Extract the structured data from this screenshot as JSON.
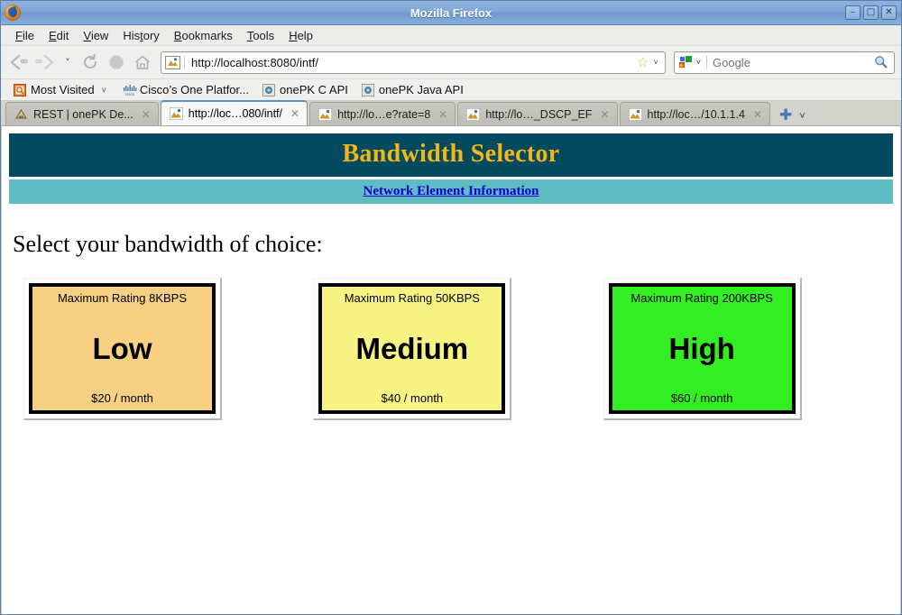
{
  "window": {
    "title": "Mozilla Firefox",
    "minimize_label": "–",
    "maximize_label": "□",
    "close_label": "✕"
  },
  "menubar": {
    "items": [
      {
        "pre": "",
        "key": "F",
        "post": "ile"
      },
      {
        "pre": "",
        "key": "E",
        "post": "dit"
      },
      {
        "pre": "",
        "key": "V",
        "post": "iew"
      },
      {
        "pre": "His",
        "key": "t",
        "post": "ory"
      },
      {
        "pre": "",
        "key": "B",
        "post": "ookmarks"
      },
      {
        "pre": "",
        "key": "T",
        "post": "ools"
      },
      {
        "pre": "",
        "key": "H",
        "post": "elp"
      }
    ]
  },
  "navbar": {
    "back_label": "❮",
    "forward_label": "❯",
    "dropmarker_label": "˅",
    "reload_label": "⟳",
    "stop_label": "⬤",
    "home_label": "⌂",
    "url": "http://localhost:8080/intf/",
    "star_label": "☆",
    "url_dropdown_label": "˅",
    "search_engine_dropdown_label": "˅",
    "search_placeholder": "Google",
    "search_value": "",
    "search_go_label": "🔍"
  },
  "bookmarks": {
    "items": [
      {
        "label": "Most Visited",
        "has_caret": true
      },
      {
        "label": "Cisco’s One Platfor...",
        "has_caret": false
      },
      {
        "label": "onePK C API",
        "has_caret": false
      },
      {
        "label": "onePK Java API",
        "has_caret": false
      }
    ],
    "caret_label": "˅"
  },
  "tabs": {
    "close_label": "✕",
    "new_tab_label": "✚",
    "list_all_label": "˅",
    "items": [
      {
        "label": "REST | onePK De...",
        "selected": false
      },
      {
        "label": "http://loc…080/intf/",
        "selected": true
      },
      {
        "label": "http://lo…e?rate=8",
        "selected": false
      },
      {
        "label": "http://lo…_DSCP_EF",
        "selected": false
      },
      {
        "label": "http://loc…/10.1.1.4",
        "selected": false
      }
    ]
  },
  "page": {
    "banner_title": "Bandwidth Selector",
    "banner_bg": "#044a5e",
    "banner_fg": "#f2b616",
    "subbanner_link": "Network Element Information",
    "subbanner_bg": "#5fbcc3",
    "subbanner_fg": "#0000cd",
    "prompt": "Select your bandwidth of choice:",
    "cards": [
      {
        "rating": "Maximum Rating 8KBPS",
        "name": "Low",
        "price": "$20 / month",
        "color": "#f7d083"
      },
      {
        "rating": "Maximum Rating 50KBPS",
        "name": "Medium",
        "price": "$40 / month",
        "color": "#f8f484"
      },
      {
        "rating": "Maximum Rating 200KBPS",
        "name": "High",
        "price": "$60 / month",
        "color": "#33ee22"
      }
    ]
  }
}
